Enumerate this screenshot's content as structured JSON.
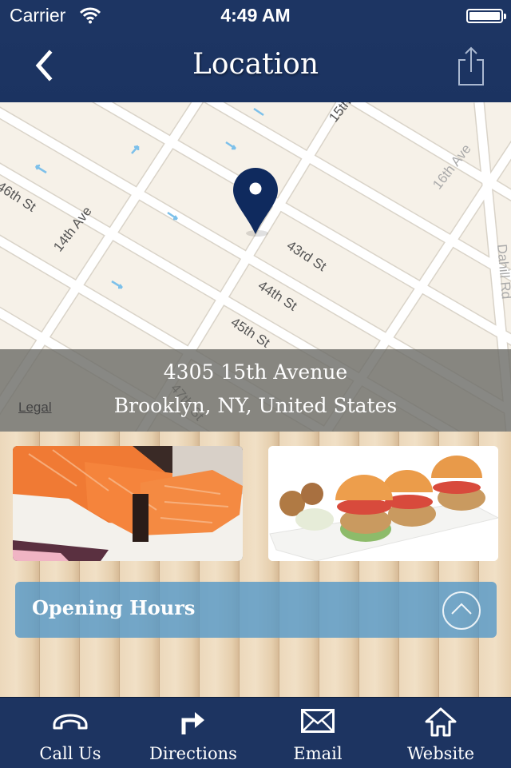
{
  "status_bar": {
    "carrier": "Carrier",
    "time": "4:49 AM",
    "battery_percent": 100
  },
  "nav": {
    "title": "Location",
    "back_icon": "chevron-left-icon",
    "share_icon": "share-icon"
  },
  "map": {
    "street_labels": [
      "14th Ave",
      "46th St",
      "15th",
      "43rd St",
      "44th St",
      "45th St",
      "47th St",
      "16th Ave",
      "Dahill Rd"
    ],
    "pin_icon": "map-pin-icon",
    "legal_label": "Legal"
  },
  "address": {
    "line1": "4305 15th Avenue",
    "line2": "Brooklyn, NY, United States"
  },
  "photos": [
    {
      "name": "sushi",
      "description": "Salmon sushi roll"
    },
    {
      "name": "sliders",
      "description": "Mini burgers on plate"
    }
  ],
  "opening_hours": {
    "label": "Opening Hours",
    "toggle_icon": "chevron-up-circle-icon"
  },
  "tab_bar": {
    "items": [
      {
        "label": "Call Us",
        "icon": "phone-icon"
      },
      {
        "label": "Directions",
        "icon": "turn-right-arrow-icon"
      },
      {
        "label": "Email",
        "icon": "envelope-icon"
      },
      {
        "label": "Website",
        "icon": "home-icon"
      }
    ]
  },
  "colors": {
    "navbar": "#1d3563",
    "pin": "#0f2a5e",
    "hours_bar": "#5096c8",
    "tabbar": "#1d3461"
  }
}
